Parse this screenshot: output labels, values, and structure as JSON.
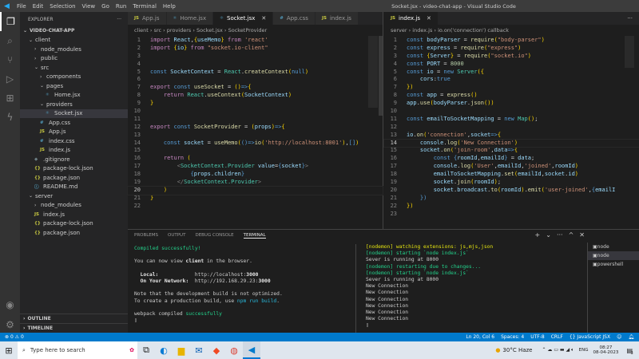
{
  "titlebar": {
    "menu": [
      "File",
      "Edit",
      "Selection",
      "View",
      "Go",
      "Run",
      "Terminal",
      "Help"
    ],
    "title": "Socket.jsx - video-chat-app - Visual Studio Code"
  },
  "sidebar": {
    "header": "EXPLORER",
    "more": "···",
    "root": "VIDEO-CHAT-APP",
    "items": [
      {
        "label": "client",
        "depth": 1,
        "type": "folder-open"
      },
      {
        "label": "node_modules",
        "depth": 2,
        "type": "folder"
      },
      {
        "label": "public",
        "depth": 2,
        "type": "folder"
      },
      {
        "label": "src",
        "depth": 2,
        "type": "folder-open"
      },
      {
        "label": "components",
        "depth": 3,
        "type": "folder"
      },
      {
        "label": "pages",
        "depth": 3,
        "type": "folder-open"
      },
      {
        "label": "Home.jsx",
        "depth": 4,
        "type": "jsx"
      },
      {
        "label": "providers",
        "depth": 3,
        "type": "folder-open"
      },
      {
        "label": "Socket.jsx",
        "depth": 4,
        "type": "jsx",
        "selected": true
      },
      {
        "label": "App.css",
        "depth": 3,
        "type": "css"
      },
      {
        "label": "App.js",
        "depth": 3,
        "type": "js"
      },
      {
        "label": "index.css",
        "depth": 3,
        "type": "css"
      },
      {
        "label": "index.js",
        "depth": 3,
        "type": "js"
      },
      {
        "label": ".gitignore",
        "depth": 2,
        "type": "git"
      },
      {
        "label": "package-lock.json",
        "depth": 2,
        "type": "json"
      },
      {
        "label": "package.json",
        "depth": 2,
        "type": "json"
      },
      {
        "label": "README.md",
        "depth": 2,
        "type": "md"
      },
      {
        "label": "server",
        "depth": 1,
        "type": "folder-open"
      },
      {
        "label": "node_modules",
        "depth": 2,
        "type": "folder"
      },
      {
        "label": "index.js",
        "depth": 2,
        "type": "js"
      },
      {
        "label": "package-lock.json",
        "depth": 2,
        "type": "json"
      },
      {
        "label": "package.json",
        "depth": 2,
        "type": "json"
      }
    ],
    "outline": "OUTLINE",
    "timeline": "TIMELINE"
  },
  "editor_left": {
    "tabs": [
      {
        "label": "App.js",
        "icon": "JS",
        "type": "js"
      },
      {
        "label": "Home.jsx",
        "icon": "⚛",
        "type": "jsx"
      },
      {
        "label": "Socket.jsx",
        "icon": "⚛",
        "type": "jsx",
        "active": true
      },
      {
        "label": "App.css",
        "icon": "#",
        "type": "css"
      },
      {
        "label": "index.js",
        "icon": "JS",
        "type": "js"
      }
    ],
    "breadcrumb": "client › src › providers › Socket.jsx › SocketProvider",
    "current_line": 20,
    "lines": [
      [
        [
          "c",
          "import "
        ],
        [
          "v",
          "React"
        ],
        [
          "w",
          ","
        ],
        [
          "p",
          "{"
        ],
        [
          "v",
          "useMemo"
        ],
        [
          "p",
          "}"
        ],
        [
          "c",
          " from "
        ],
        [
          "s",
          "'react'"
        ]
      ],
      [
        [
          "c",
          "import "
        ],
        [
          "p",
          "{"
        ],
        [
          "v",
          "io"
        ],
        [
          "p",
          "}"
        ],
        [
          "c",
          " from "
        ],
        [
          "s",
          "\"socket.io-client\""
        ]
      ],
      [],
      [],
      [
        [
          "k",
          "const "
        ],
        [
          "v",
          "SocketContext"
        ],
        [
          "w",
          " = "
        ],
        [
          "t",
          "React"
        ],
        [
          "w",
          "."
        ],
        [
          "f",
          "createContext"
        ],
        [
          "p",
          "("
        ],
        [
          "k",
          "null"
        ],
        [
          "p",
          ")"
        ]
      ],
      [],
      [
        [
          "c",
          "export "
        ],
        [
          "k",
          "const "
        ],
        [
          "f",
          "useSocket"
        ],
        [
          "w",
          " = "
        ],
        [
          "p",
          "()"
        ],
        [
          "k",
          "=>"
        ],
        [
          "p",
          "{"
        ]
      ],
      [
        [
          "c",
          "    return "
        ],
        [
          "t",
          "React"
        ],
        [
          "w",
          "."
        ],
        [
          "f",
          "useContext"
        ],
        [
          "p",
          "("
        ],
        [
          "v",
          "SocketContext"
        ],
        [
          "p",
          ")"
        ]
      ],
      [
        [
          "p",
          "}"
        ]
      ],
      [],
      [],
      [
        [
          "c",
          "export "
        ],
        [
          "k",
          "const "
        ],
        [
          "f",
          "SocketProvider"
        ],
        [
          "w",
          " = "
        ],
        [
          "p",
          "("
        ],
        [
          "v",
          "props"
        ],
        [
          "p",
          ")"
        ],
        [
          "k",
          "=>"
        ],
        [
          "p",
          "{"
        ]
      ],
      [],
      [
        [
          "k",
          "    const "
        ],
        [
          "v",
          "socket"
        ],
        [
          "w",
          " = "
        ],
        [
          "f",
          "useMemo"
        ],
        [
          "p",
          "("
        ],
        [
          "k",
          "()=>"
        ],
        [
          "f",
          "io"
        ],
        [
          "p",
          "("
        ],
        [
          "s",
          "'http://localhost:8001'"
        ],
        [
          "p",
          ")"
        ],
        [
          "w",
          ","
        ],
        [
          "k",
          "[]"
        ],
        [
          "p",
          ")"
        ]
      ],
      [],
      [
        [
          "c",
          "    return "
        ],
        [
          "p",
          "("
        ]
      ],
      [
        [
          "g",
          "        <"
        ],
        [
          "t",
          "SocketContext.Provider"
        ],
        [
          "v",
          " value"
        ],
        [
          "w",
          "="
        ],
        [
          "k",
          "{"
        ],
        [
          "v",
          "socket"
        ],
        [
          "k",
          "}"
        ],
        [
          "g",
          ">"
        ]
      ],
      [
        [
          "k",
          "            {"
        ],
        [
          "v",
          "props.children"
        ],
        [
          "k",
          "}"
        ]
      ],
      [
        [
          "g",
          "        </"
        ],
        [
          "t",
          "SocketContext.Provider"
        ],
        [
          "g",
          ">"
        ]
      ],
      [
        [
          "p",
          "    )"
        ]
      ],
      [
        [
          "p",
          "}"
        ]
      ],
      []
    ]
  },
  "editor_right": {
    "tabs": [
      {
        "label": "index.js",
        "icon": "JS",
        "type": "js",
        "active": true
      }
    ],
    "more": "···",
    "breadcrumb": "server › index.js › io.on('connection') callback",
    "current_line": 14,
    "lines": [
      [
        [
          "k",
          "const "
        ],
        [
          "v",
          "bodyParser"
        ],
        [
          "w",
          " = "
        ],
        [
          "f",
          "require"
        ],
        [
          "p",
          "("
        ],
        [
          "s",
          "\"body-parser\""
        ],
        [
          "p",
          ")"
        ]
      ],
      [
        [
          "k",
          "const "
        ],
        [
          "v",
          "express"
        ],
        [
          "w",
          " = "
        ],
        [
          "f",
          "require"
        ],
        [
          "p",
          "("
        ],
        [
          "s",
          "\"express\""
        ],
        [
          "p",
          ")"
        ]
      ],
      [
        [
          "k",
          "const "
        ],
        [
          "p",
          "{"
        ],
        [
          "v",
          "Server"
        ],
        [
          "p",
          "}"
        ],
        [
          "w",
          " = "
        ],
        [
          "f",
          "require"
        ],
        [
          "p",
          "("
        ],
        [
          "s",
          "\"socket.io\""
        ],
        [
          "p",
          ")"
        ]
      ],
      [
        [
          "k",
          "const "
        ],
        [
          "v",
          "PORT"
        ],
        [
          "w",
          " = "
        ],
        [
          "n",
          "8000"
        ]
      ],
      [
        [
          "k",
          "const "
        ],
        [
          "v",
          "io"
        ],
        [
          "w",
          " = "
        ],
        [
          "k",
          "new "
        ],
        [
          "t",
          "Server"
        ],
        [
          "p",
          "({"
        ]
      ],
      [
        [
          "v",
          "    cors"
        ],
        [
          "w",
          ":"
        ],
        [
          "k",
          "true"
        ]
      ],
      [
        [
          "p",
          "})"
        ]
      ],
      [
        [
          "k",
          "const "
        ],
        [
          "v",
          "app"
        ],
        [
          "w",
          " = "
        ],
        [
          "f",
          "express"
        ],
        [
          "p",
          "()"
        ]
      ],
      [
        [
          "v",
          "app"
        ],
        [
          "w",
          "."
        ],
        [
          "f",
          "use"
        ],
        [
          "p",
          "("
        ],
        [
          "v",
          "bodyParser"
        ],
        [
          "w",
          "."
        ],
        [
          "f",
          "json"
        ],
        [
          "p",
          "())"
        ]
      ],
      [],
      [
        [
          "k",
          "const "
        ],
        [
          "v",
          "emailToSocketMapping"
        ],
        [
          "w",
          " = "
        ],
        [
          "k",
          "new "
        ],
        [
          "t",
          "Map"
        ],
        [
          "p",
          "()"
        ],
        [
          "w",
          ";"
        ]
      ],
      [],
      [
        [
          "v",
          "io"
        ],
        [
          "w",
          "."
        ],
        [
          "f",
          "on"
        ],
        [
          "p",
          "("
        ],
        [
          "s",
          "'connection'"
        ],
        [
          "w",
          ","
        ],
        [
          "v",
          "socket"
        ],
        [
          "k",
          "=>"
        ],
        [
          "p",
          "{"
        ]
      ],
      [
        [
          "v",
          "    console"
        ],
        [
          "w",
          "."
        ],
        [
          "f",
          "log"
        ],
        [
          "p",
          "("
        ],
        [
          "s",
          "'New Connection'"
        ],
        [
          "p",
          ")"
        ]
      ],
      [
        [
          "v",
          "    socket"
        ],
        [
          "w",
          "."
        ],
        [
          "f",
          "on"
        ],
        [
          "p",
          "("
        ],
        [
          "s",
          "'join-room'"
        ],
        [
          "w",
          ","
        ],
        [
          "v",
          "data"
        ],
        [
          "k",
          "=>"
        ],
        [
          "p",
          "{"
        ]
      ],
      [
        [
          "k",
          "        const "
        ],
        [
          "k",
          "{"
        ],
        [
          "v",
          "roomId"
        ],
        [
          "w",
          ","
        ],
        [
          "v",
          "emailId"
        ],
        [
          "k",
          "}"
        ],
        [
          "w",
          " = "
        ],
        [
          "v",
          "data"
        ],
        [
          "w",
          ";"
        ]
      ],
      [
        [
          "v",
          "        console"
        ],
        [
          "w",
          "."
        ],
        [
          "f",
          "log"
        ],
        [
          "p",
          "("
        ],
        [
          "s",
          "'User'"
        ],
        [
          "w",
          ","
        ],
        [
          "v",
          "emailId"
        ],
        [
          "w",
          ","
        ],
        [
          "s",
          "'joined'"
        ],
        [
          "w",
          ","
        ],
        [
          "v",
          "roomId"
        ],
        [
          "p",
          ")"
        ]
      ],
      [
        [
          "v",
          "        emailToSocketMapping"
        ],
        [
          "w",
          "."
        ],
        [
          "f",
          "set"
        ],
        [
          "p",
          "("
        ],
        [
          "v",
          "emailId"
        ],
        [
          "w",
          ","
        ],
        [
          "v",
          "socket"
        ],
        [
          "w",
          "."
        ],
        [
          "v",
          "id"
        ],
        [
          "p",
          ")"
        ]
      ],
      [
        [
          "v",
          "        socket"
        ],
        [
          "w",
          "."
        ],
        [
          "f",
          "join"
        ],
        [
          "p",
          "("
        ],
        [
          "v",
          "roomId"
        ],
        [
          "p",
          ")"
        ],
        [
          "w",
          ";"
        ]
      ],
      [
        [
          "v",
          "        socket"
        ],
        [
          "w",
          "."
        ],
        [
          "v",
          "broadcast"
        ],
        [
          "w",
          "."
        ],
        [
          "f",
          "to"
        ],
        [
          "p",
          "("
        ],
        [
          "v",
          "roomId"
        ],
        [
          "p",
          ")"
        ],
        [
          "w",
          "."
        ],
        [
          "f",
          "emit"
        ],
        [
          "p",
          "("
        ],
        [
          "s",
          "'user-joined'"
        ],
        [
          "w",
          ","
        ],
        [
          "k",
          "{"
        ],
        [
          "v",
          "emailI"
        ]
      ],
      [
        [
          "k",
          "    })"
        ]
      ],
      [
        [
          "p",
          "})"
        ]
      ],
      []
    ]
  },
  "panel": {
    "tabs": [
      "PROBLEMS",
      "OUTPUT",
      "DEBUG CONSOLE",
      "TERMINAL"
    ],
    "active_tab": "TERMINAL",
    "actions": [
      "+",
      "⌄",
      "···",
      "^",
      "✕"
    ],
    "terminal_left": [
      [
        [
          "tg",
          "Compiled successfully!"
        ]
      ],
      [],
      [
        [
          "",
          "You can now view "
        ],
        [
          "tb",
          "client"
        ],
        [
          "",
          " in the browser."
        ]
      ],
      [],
      [
        [
          "tb",
          "  Local:"
        ],
        [
          "",
          "            http://localhost:"
        ],
        [
          "tb",
          "3000"
        ]
      ],
      [
        [
          "tb",
          "  On Your Network:"
        ],
        [
          "",
          "  http://192.168.29.23:"
        ],
        [
          "tb",
          "3000"
        ]
      ],
      [],
      [
        [
          "",
          "Note that the development build is not optimized."
        ]
      ],
      [
        [
          "",
          "To create a production build, use "
        ],
        [
          "tc",
          "npm run build"
        ],
        [
          "",
          "."
        ]
      ],
      [],
      [
        [
          "",
          "webpack compiled "
        ],
        [
          "tg",
          "successfully"
        ]
      ],
      [
        [
          "",
          "▯"
        ]
      ]
    ],
    "terminal_right": [
      [
        [
          "ty",
          "[nodemon] watching extensions: js,mjs,json"
        ]
      ],
      [
        [
          "tg",
          "[nodemon] starting `node index.js`"
        ]
      ],
      [
        [
          "",
          "Sever is running at 8000"
        ]
      ],
      [
        [
          "tg",
          "[nodemon] restarting due to changes..."
        ]
      ],
      [
        [
          "tg",
          "[nodemon] starting `node index.js`"
        ]
      ],
      [
        [
          "",
          "Sever is running at 8000"
        ]
      ],
      [
        [
          "",
          "New Connection"
        ]
      ],
      [
        [
          "",
          "New Connection"
        ]
      ],
      [
        [
          "",
          "New Connection"
        ]
      ],
      [
        [
          "",
          "New Connection"
        ]
      ],
      [
        [
          "",
          "New Connection"
        ]
      ],
      [
        [
          "",
          "New Connection"
        ]
      ],
      [
        [
          "",
          "▯"
        ]
      ]
    ],
    "terminals": [
      "node",
      "node",
      "powershell"
    ]
  },
  "statusbar": {
    "errors": "0",
    "warnings": "0",
    "position": "Ln 20, Col 6",
    "spaces": "Spaces: 4",
    "encoding": "UTF-8",
    "eol": "CRLF",
    "language": "{} JavaScript JSX"
  },
  "taskbar": {
    "search_placeholder": "Type here to search",
    "weather": "30°C  Haze",
    "lang": "ENG",
    "time": "08:27",
    "date": "08-04-2023",
    "notifications": "3"
  }
}
